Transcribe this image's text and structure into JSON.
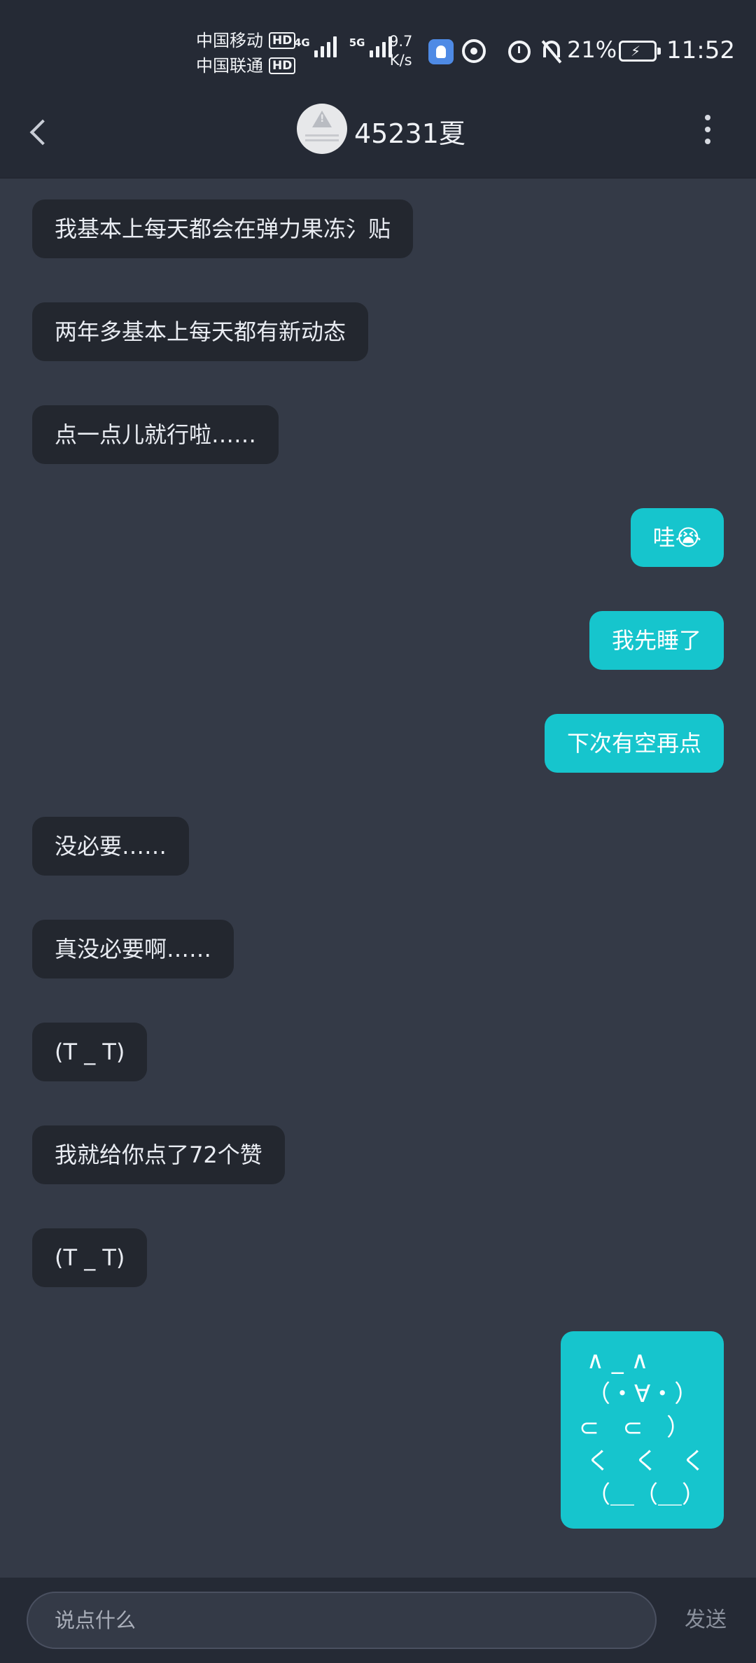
{
  "status_bar": {
    "carrier1": "中国移动",
    "carrier2": "中国联通",
    "hd": "HD",
    "net1": "4G",
    "net2": "5G",
    "speed_value": "9.7",
    "speed_unit": "K/s",
    "battery_percent": "21%",
    "time": "11:52"
  },
  "header": {
    "title": "45231夏"
  },
  "messages": [
    {
      "side": "left",
      "text": "我基本上每天都会在弹力果冻氵贴"
    },
    {
      "side": "left",
      "text": "两年多基本上每天都有新动态"
    },
    {
      "side": "left",
      "text": "点一点儿就行啦……"
    },
    {
      "side": "right",
      "text": "哇😭"
    },
    {
      "side": "right",
      "text": "我先睡了"
    },
    {
      "side": "right",
      "text": "下次有空再点"
    },
    {
      "side": "left",
      "text": "没必要……"
    },
    {
      "side": "left",
      "text": "真没必要啊……"
    },
    {
      "side": "left",
      "text": "(T _ T)"
    },
    {
      "side": "left",
      "text": "我就给你点了72个赞"
    },
    {
      "side": "left",
      "text": "(T _ T)"
    },
    {
      "side": "right",
      "text": " ∧ _ ∧\n （・∀・）\n⊂　⊂　）\n く　く　く\n （＿（＿）"
    }
  ],
  "input": {
    "placeholder": "说点什么",
    "send_label": "发送"
  },
  "icons": {
    "back": "chevron-left-icon",
    "more": "more-vertical-icon",
    "alarm": "alarm-icon",
    "mute": "bell-off-icon",
    "battery": "battery-charging-icon"
  }
}
